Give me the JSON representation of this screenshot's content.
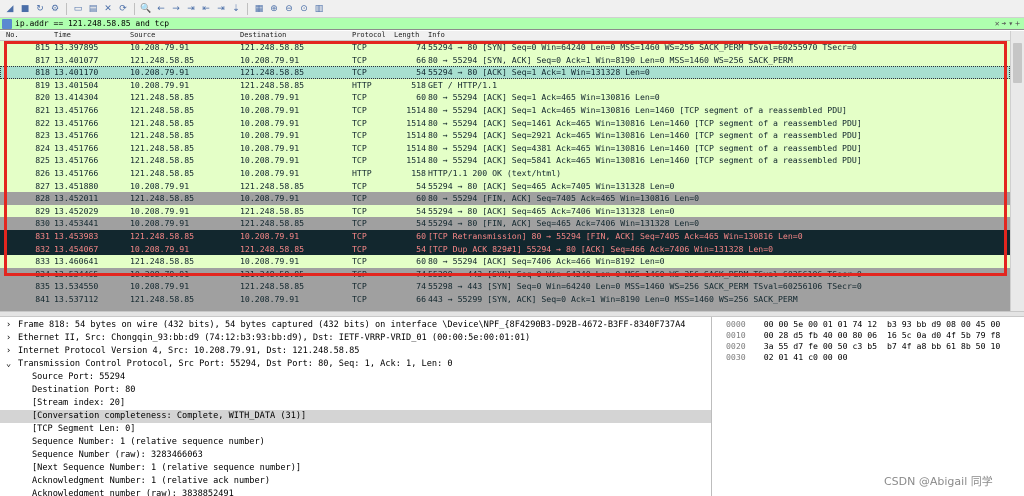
{
  "filter": {
    "value": "ip.addr == 121.248.58.85 and tcp"
  },
  "columns": [
    "No.",
    "Time",
    "Source",
    "Destination",
    "Protocol",
    "Length",
    "Info"
  ],
  "rows": [
    {
      "no": "815",
      "time": "13.397895",
      "src": "10.208.79.91",
      "dst": "121.248.58.85",
      "proto": "TCP",
      "len": "74",
      "info": "55294 → 80 [SYN] Seq=0 Win=64240 Len=0 MSS=1460 WS=256 SACK_PERM TSval=60255970 TSecr=0",
      "bg": "#e4ffc7",
      "fg": "#12272e"
    },
    {
      "no": "817",
      "time": "13.401077",
      "src": "121.248.58.85",
      "dst": "10.208.79.91",
      "proto": "TCP",
      "len": "66",
      "info": "80 → 55294 [SYN, ACK] Seq=0 Ack=1 Win=8190 Len=0 MSS=1460 WS=256 SACK_PERM",
      "bg": "#e4ffc7",
      "fg": "#12272e"
    },
    {
      "no": "818",
      "time": "13.401170",
      "src": "10.208.79.91",
      "dst": "121.248.58.85",
      "proto": "TCP",
      "len": "54",
      "info": "55294 → 80 [ACK] Seq=1 Ack=1 Win=131328 Len=0",
      "bg": "#a8e0d0",
      "fg": "#12272e"
    },
    {
      "no": "819",
      "time": "13.401504",
      "src": "10.208.79.91",
      "dst": "121.248.58.85",
      "proto": "HTTP",
      "len": "518",
      "info": "GET / HTTP/1.1",
      "bg": "#e4ffc7",
      "fg": "#12272e"
    },
    {
      "no": "820",
      "time": "13.414304",
      "src": "121.248.58.85",
      "dst": "10.208.79.91",
      "proto": "TCP",
      "len": "60",
      "info": "80 → 55294 [ACK] Seq=1 Ack=465 Win=130816 Len=0",
      "bg": "#e4ffc7",
      "fg": "#12272e"
    },
    {
      "no": "821",
      "time": "13.451766",
      "src": "121.248.58.85",
      "dst": "10.208.79.91",
      "proto": "TCP",
      "len": "1514",
      "info": "80 → 55294 [ACK] Seq=1 Ack=465 Win=130816 Len=1460 [TCP segment of a reassembled PDU]",
      "bg": "#e4ffc7",
      "fg": "#12272e"
    },
    {
      "no": "822",
      "time": "13.451766",
      "src": "121.248.58.85",
      "dst": "10.208.79.91",
      "proto": "TCP",
      "len": "1514",
      "info": "80 → 55294 [ACK] Seq=1461 Ack=465 Win=130816 Len=1460 [TCP segment of a reassembled PDU]",
      "bg": "#e4ffc7",
      "fg": "#12272e"
    },
    {
      "no": "823",
      "time": "13.451766",
      "src": "121.248.58.85",
      "dst": "10.208.79.91",
      "proto": "TCP",
      "len": "1514",
      "info": "80 → 55294 [ACK] Seq=2921 Ack=465 Win=130816 Len=1460 [TCP segment of a reassembled PDU]",
      "bg": "#e4ffc7",
      "fg": "#12272e"
    },
    {
      "no": "824",
      "time": "13.451766",
      "src": "121.248.58.85",
      "dst": "10.208.79.91",
      "proto": "TCP",
      "len": "1514",
      "info": "80 → 55294 [ACK] Seq=4381 Ack=465 Win=130816 Len=1460 [TCP segment of a reassembled PDU]",
      "bg": "#e4ffc7",
      "fg": "#12272e"
    },
    {
      "no": "825",
      "time": "13.451766",
      "src": "121.248.58.85",
      "dst": "10.208.79.91",
      "proto": "TCP",
      "len": "1514",
      "info": "80 → 55294 [ACK] Seq=5841 Ack=465 Win=130816 Len=1460 [TCP segment of a reassembled PDU]",
      "bg": "#e4ffc7",
      "fg": "#12272e"
    },
    {
      "no": "826",
      "time": "13.451766",
      "src": "121.248.58.85",
      "dst": "10.208.79.91",
      "proto": "HTTP",
      "len": "158",
      "info": "HTTP/1.1 200 OK  (text/html)",
      "bg": "#e4ffc7",
      "fg": "#12272e"
    },
    {
      "no": "827",
      "time": "13.451880",
      "src": "10.208.79.91",
      "dst": "121.248.58.85",
      "proto": "TCP",
      "len": "54",
      "info": "55294 → 80 [ACK] Seq=465 Ack=7405 Win=131328 Len=0",
      "bg": "#e4ffc7",
      "fg": "#12272e"
    },
    {
      "no": "828",
      "time": "13.452011",
      "src": "121.248.58.85",
      "dst": "10.208.79.91",
      "proto": "TCP",
      "len": "60",
      "info": "80 → 55294 [FIN, ACK] Seq=7405 Ack=465 Win=130816 Len=0",
      "bg": "#a0a0a0",
      "fg": "#12272e"
    },
    {
      "no": "829",
      "time": "13.452029",
      "src": "10.208.79.91",
      "dst": "121.248.58.85",
      "proto": "TCP",
      "len": "54",
      "info": "55294 → 80 [ACK] Seq=465 Ack=7406 Win=131328 Len=0",
      "bg": "#e4ffc7",
      "fg": "#12272e"
    },
    {
      "no": "830",
      "time": "13.453441",
      "src": "10.208.79.91",
      "dst": "121.248.58.85",
      "proto": "TCP",
      "len": "54",
      "info": "55294 → 80 [FIN, ACK] Seq=465 Ack=7406 Win=131328 Len=0",
      "bg": "#a0a0a0",
      "fg": "#12272e"
    },
    {
      "no": "831",
      "time": "13.453983",
      "src": "121.248.58.85",
      "dst": "10.208.79.91",
      "proto": "TCP",
      "len": "60",
      "info": "[TCP Retransmission] 80 → 55294 [FIN, ACK] Seq=7405 Ack=465 Win=130816 Len=0",
      "bg": "#12272e",
      "fg": "#f78787"
    },
    {
      "no": "832",
      "time": "13.454067",
      "src": "10.208.79.91",
      "dst": "121.248.58.85",
      "proto": "TCP",
      "len": "54",
      "info": "[TCP Dup ACK 829#1] 55294 → 80 [ACK] Seq=466 Ack=7406 Win=131328 Len=0",
      "bg": "#12272e",
      "fg": "#f78787"
    },
    {
      "no": "833",
      "time": "13.460641",
      "src": "121.248.58.85",
      "dst": "10.208.79.91",
      "proto": "TCP",
      "len": "60",
      "info": "80 → 55294 [ACK] Seq=7406 Ack=466 Win=8192 Len=0",
      "bg": "#e4ffc7",
      "fg": "#12272e"
    },
    {
      "no": "834",
      "time": "13.534465",
      "src": "10.208.79.91",
      "dst": "121.248.58.85",
      "proto": "TCP",
      "len": "74",
      "info": "55299 → 443 [SYN] Seq=0 Win=64240 Len=0 MSS=1460 WS=256 SACK_PERM TSval=60256106 TSecr=0",
      "bg": "#a0a0a0",
      "fg": "#12272e"
    },
    {
      "no": "835",
      "time": "13.534550",
      "src": "10.208.79.91",
      "dst": "121.248.58.85",
      "proto": "TCP",
      "len": "74",
      "info": "55298 → 443 [SYN] Seq=0 Win=64240 Len=0 MSS=1460 WS=256 SACK_PERM TSval=60256106 TSecr=0",
      "bg": "#a0a0a0",
      "fg": "#12272e"
    },
    {
      "no": "841",
      "time": "13.537112",
      "src": "121.248.58.85",
      "dst": "10.208.79.91",
      "proto": "TCP",
      "len": "66",
      "info": "443 → 55299 [SYN, ACK] Seq=0 Ack=1 Win=8190 Len=0 MSS=1460 WS=256 SACK_PERM",
      "bg": "#a0a0a0",
      "fg": "#12272e"
    }
  ],
  "details": [
    {
      "arrow": "›",
      "text": "Frame 818: 54 bytes on wire (432 bits), 54 bytes captured (432 bits) on interface \\Device\\NPF_{8F4290B3-D92B-4672-B3FF-8340F737A4",
      "indent": 0,
      "sel": false
    },
    {
      "arrow": "›",
      "text": "Ethernet II, Src: Chongqin_93:bb:d9 (74:12:b3:93:bb:d9), Dst: IETF-VRRP-VRID_01 (00:00:5e:00:01:01)",
      "indent": 0,
      "sel": false
    },
    {
      "arrow": "›",
      "text": "Internet Protocol Version 4, Src: 10.208.79.91, Dst: 121.248.58.85",
      "indent": 0,
      "sel": false
    },
    {
      "arrow": "⌄",
      "text": "Transmission Control Protocol, Src Port: 55294, Dst Port: 80, Seq: 1, Ack: 1, Len: 0",
      "indent": 0,
      "sel": false
    },
    {
      "arrow": "",
      "text": "Source Port: 55294",
      "indent": 1,
      "sel": false
    },
    {
      "arrow": "",
      "text": "Destination Port: 80",
      "indent": 1,
      "sel": false
    },
    {
      "arrow": "",
      "text": "[Stream index: 20]",
      "indent": 1,
      "sel": false
    },
    {
      "arrow": "",
      "text": "[Conversation completeness: Complete, WITH_DATA (31)]",
      "indent": 1,
      "sel": true
    },
    {
      "arrow": "",
      "text": "[TCP Segment Len: 0]",
      "indent": 1,
      "sel": false
    },
    {
      "arrow": "",
      "text": "Sequence Number: 1    (relative sequence number)",
      "indent": 1,
      "sel": false
    },
    {
      "arrow": "",
      "text": "Sequence Number (raw): 3283466063",
      "indent": 1,
      "sel": false
    },
    {
      "arrow": "",
      "text": "[Next Sequence Number: 1    (relative sequence number)]",
      "indent": 1,
      "sel": false
    },
    {
      "arrow": "",
      "text": "Acknowledgment Number: 1    (relative ack number)",
      "indent": 1,
      "sel": false
    },
    {
      "arrow": "",
      "text": "Acknowledgment number (raw): 3838852491",
      "indent": 1,
      "sel": false
    }
  ],
  "bytes": [
    {
      "off": "0000",
      "hex": "00 00 5e 00 01 01 74 12  b3 93 bb d9 08 00 45 00"
    },
    {
      "off": "0010",
      "hex": "00 28 d5 fb 40 00 80 06  16 5c 0a d0 4f 5b 79 f8"
    },
    {
      "off": "0020",
      "hex": "3a 55 d7 fe 00 50 c3 b5  b7 4f a8 bb 61 8b 50 10"
    },
    {
      "off": "0030",
      "hex": "02 01 41 c0 00 00"
    }
  ],
  "watermark": "CSDN @Abigail 同学",
  "colors": {
    "highlight_border": "#e3261f",
    "filter_bg": "#afffaf"
  },
  "icons": [
    "shark-fin-icon",
    "square-stop-icon",
    "restart-icon",
    "settings-icon",
    "open-folder-icon",
    "save-file-icon",
    "close-file-icon",
    "reload-icon",
    "find-icon",
    "go-back-icon",
    "go-forward-icon",
    "go-to-packet-icon",
    "first-packet-icon",
    "last-packet-icon",
    "autoscroll-icon",
    "colorize-icon",
    "zoom-in-icon",
    "zoom-out-icon",
    "normal-size-icon",
    "resize-columns-icon"
  ]
}
